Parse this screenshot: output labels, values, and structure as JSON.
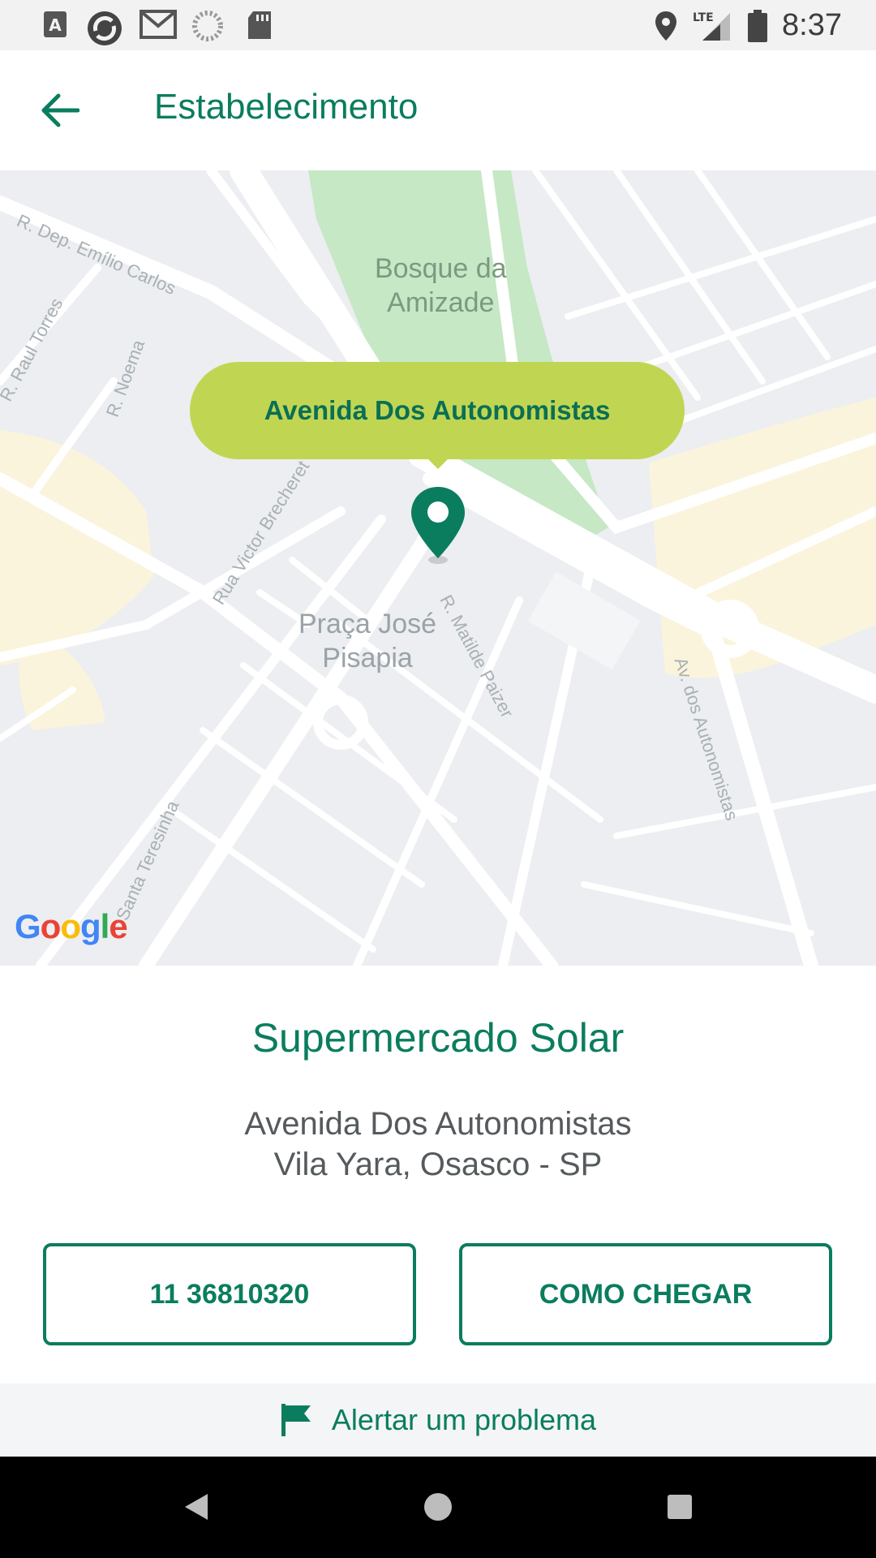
{
  "status_bar": {
    "time": "8:37",
    "network": "LTE",
    "icons": [
      "a-icon",
      "sync-icon",
      "gmail-icon",
      "loading-icon",
      "sd-card-icon",
      "location-icon",
      "signal-icon",
      "battery-icon"
    ]
  },
  "app_bar": {
    "title": "Estabelecimento",
    "back_icon": "arrow-back-icon"
  },
  "map": {
    "callout": "Avenida Dos Autonomistas",
    "labels": {
      "park": "Bosque da\nAmizade",
      "square": "Praça José\nPisapia"
    },
    "streets": {
      "emilio": "R. Dep. Emílio Carlos",
      "raul": "R. Raul Torres",
      "noema": "R. Noema",
      "victor": "Rua Victor Brecheret",
      "matilde": "R. Matilde Paizer",
      "autonomistas": "Av. dos Autonomistas",
      "teresinha": "Santa Teresinha"
    },
    "logo": "Google"
  },
  "place": {
    "name": "Supermercado Solar",
    "address_line1": "Avenida Dos Autonomistas",
    "address_line2": "Vila Yara, Osasco - SP"
  },
  "actions": {
    "phone": "11 36810320",
    "directions": "COMO CHEGAR"
  },
  "alert": {
    "label": "Alertar um problema",
    "icon": "flag-icon"
  },
  "colors": {
    "primary": "#0a7d5e",
    "callout": "#c0d652",
    "park": "#c6e8c5"
  }
}
